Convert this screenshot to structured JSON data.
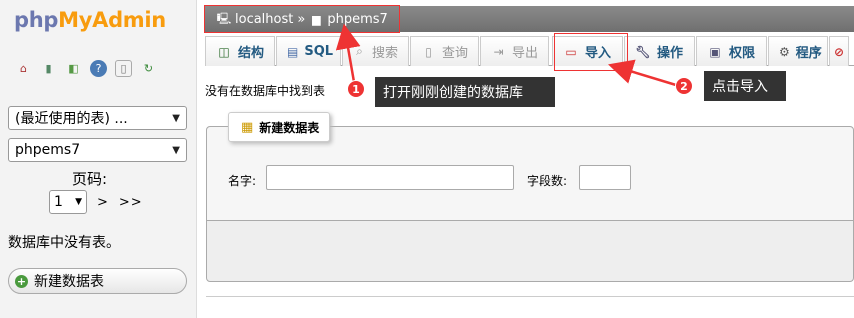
{
  "logo": {
    "php": "php",
    "my": "My",
    "admin": "Admin"
  },
  "nav": {
    "recent_tables": "(最近使用的表) ...",
    "database": "phpems7",
    "page_label": "页码:",
    "page_value": "1",
    "pager_next": ">",
    "pager_last": ">>",
    "no_tables": "数据库中没有表。",
    "new_table": "新建数据表"
  },
  "breadcrumb": {
    "server": "localhost",
    "separator": "»",
    "database": "phpems7"
  },
  "tabs": {
    "structure": "结构",
    "sql": "SQL",
    "search": "搜索",
    "query": "查询",
    "export": "导出",
    "import": "导入",
    "operations": "操作",
    "privileges": "权限",
    "routines": "程序"
  },
  "content": {
    "no_tables_msg": "没有在数据库中找到表",
    "create_legend": "新建数据表",
    "name_label": "名字:",
    "columns_label": "字段数:"
  },
  "callouts": {
    "badge_1": "1",
    "text_1": "打开刚刚创建的数据库",
    "badge_2": "2",
    "text_2": "点击导入"
  },
  "colors": {
    "highlight": "#e33333",
    "callout_bg": "#333333",
    "tab_text": "#235a81"
  }
}
